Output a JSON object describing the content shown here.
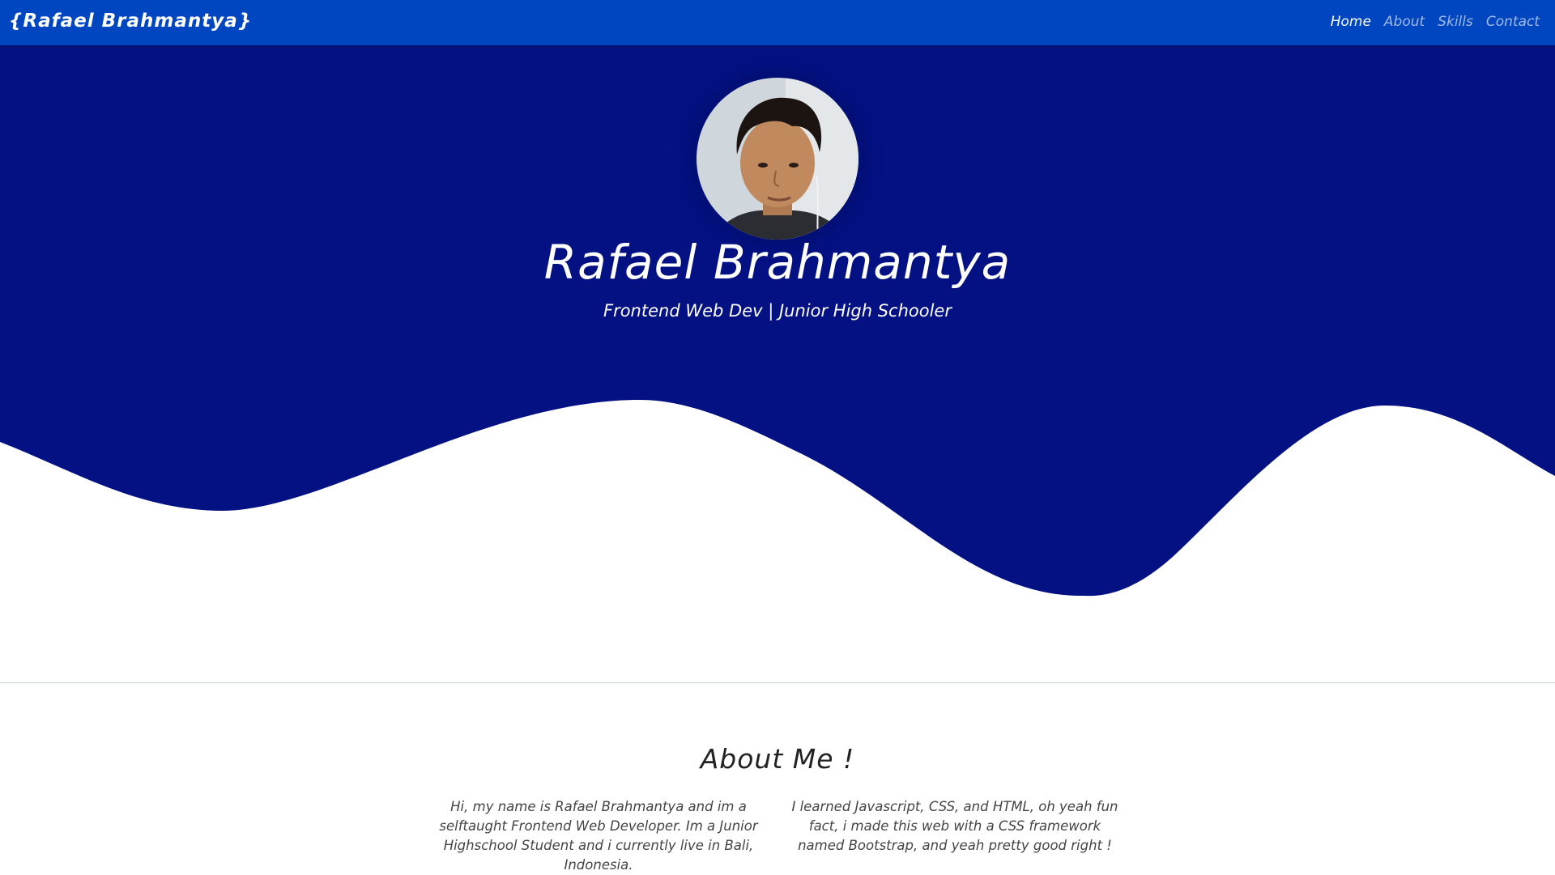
{
  "navbar": {
    "brand": "{Rafael Brahmantya}",
    "links": [
      {
        "label": "Home",
        "active": true
      },
      {
        "label": "About",
        "active": false
      },
      {
        "label": "Skills",
        "active": false
      },
      {
        "label": "Contact",
        "active": false
      }
    ]
  },
  "hero": {
    "name": "Rafael Brahmantya",
    "tagline": "Frontend Web Dev | Junior High Schooler"
  },
  "about": {
    "title": "About Me !",
    "paragraph_left": "Hi, my name is Rafael Brahmantya and im a selftaught Frontend Web Developer. Im a Junior Highschool Student and i currently live in Bali, Indonesia.",
    "paragraph_right": "I learned Javascript, CSS, and HTML, oh yeah fun fact, i made this web with a CSS framework named Bootstrap, and yeah pretty good right !"
  },
  "colors": {
    "navbar": "#0046c0",
    "hero_background": "#031183",
    "page_background": "#ffffff",
    "accent_text": "#ffffff"
  },
  "icons": {
    "avatar": "profile-photo"
  }
}
